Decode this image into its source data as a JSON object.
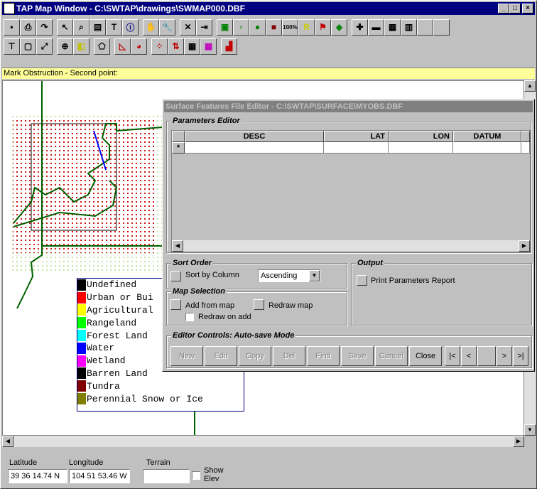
{
  "window": {
    "title": "TAP Map Window - C:\\SWTAP\\drawings\\SWMAP000.DBF",
    "minimize": "_",
    "maximize": "□",
    "close": "×"
  },
  "toolbar1": [
    "save-icon",
    "print-icon",
    "redo-icon",
    "pointer-icon",
    "zoom-icon",
    "select-icon",
    "text-icon",
    "info-icon",
    "pan-icon",
    "tool-icon",
    "delete-icon",
    "import-icon",
    "layer-icon",
    "point-icon",
    "pin-icon",
    "stop-icon",
    "100%",
    "letter-R-icon",
    "flag-icon",
    "marker-icon",
    "plus-icon",
    "ruler-icon",
    "grid-icon",
    "notes-icon"
  ],
  "toolbar2": [
    "line-icon",
    "box-icon",
    "expand-icon",
    "crosshair-icon",
    "color-swap-icon",
    "polygon-icon",
    "area-icon",
    "pie-icon",
    "scatter-icon",
    "arrows-icon",
    "raster-icon",
    "raster2-icon",
    "chart-icon"
  ],
  "status": "Mark Obstruction - Second point:",
  "legend": {
    "items": [
      {
        "label": "Undefined",
        "color": "#000000"
      },
      {
        "label": "Urban or Bui",
        "color": "#ff0000"
      },
      {
        "label": "Agricultural",
        "color": "#ffff00"
      },
      {
        "label": "Rangeland",
        "color": "#00ff00"
      },
      {
        "label": "Forest Land",
        "color": "#00ffff"
      },
      {
        "label": "Water",
        "color": "#0000ff"
      },
      {
        "label": "Wetland",
        "color": "#ff00ff"
      },
      {
        "label": "Barren Land",
        "color": "#000000"
      },
      {
        "label": "Tundra",
        "color": "#800000"
      },
      {
        "label": "Perennial Snow or Ice",
        "color": "#808000"
      }
    ]
  },
  "bottom": {
    "latitude_label": "Latitude",
    "latitude": "39 36 14.74 N",
    "longitude_label": "Longitude",
    "longitude": "104 51 53.46 W",
    "terrain_label": "Terrain",
    "terrain": "",
    "show_elev": "Show Elev"
  },
  "dialog": {
    "title": "Surface Features File Editor - C:\\SWTAP\\SURFACE\\MYOBS.DBF",
    "params_title": "Parameters Editor",
    "columns": [
      "DESC",
      "LAT",
      "LON",
      "DATUM"
    ],
    "new_row_marker": "*",
    "sort_title": "Sort Order",
    "sort_by_column": "Sort by Column",
    "sort_value": "Ascending",
    "output_title": "Output",
    "print_report": "Print Parameters Report",
    "map_title": "Map Selection",
    "add_from_map": "Add from map",
    "redraw_map": "Redraw map",
    "redraw_on_add": "Redraw on add",
    "controls_title": "Editor Controls: Auto-save Mode",
    "buttons": [
      "New",
      "Edit",
      "Copy",
      "Del",
      "Find",
      "Save",
      "Cancel",
      "Close"
    ],
    "nav": [
      "|<",
      "<",
      ">",
      ">|"
    ]
  }
}
